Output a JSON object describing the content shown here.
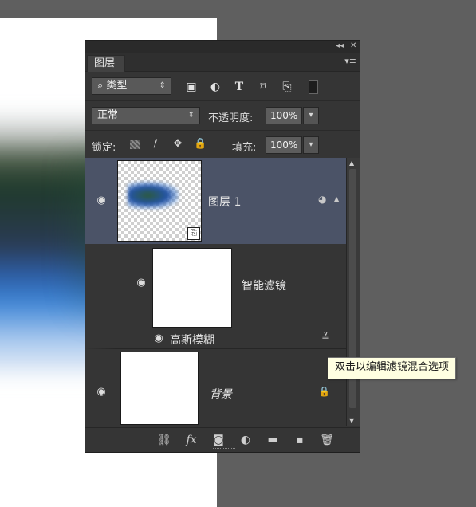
{
  "panel": {
    "tab_label": "图层",
    "panel_menu_icon": "panel-menu-icon",
    "top_controls": [
      "collapse-icon",
      "close-icon"
    ]
  },
  "filter": {
    "kind_label": "类型",
    "icons": [
      "pixel-filter-icon",
      "adjustment-filter-icon",
      "type-filter-icon",
      "shape-filter-icon",
      "smart-object-filter-icon",
      "filter-toggle-icon"
    ]
  },
  "blend": {
    "mode": "正常",
    "opacity_label": "不透明度:",
    "opacity_value": "100%"
  },
  "lock": {
    "label": "锁定:",
    "icons": [
      "lock-transparent-icon",
      "lock-pixels-icon",
      "lock-position-icon",
      "lock-all-icon"
    ],
    "fill_label": "填充:",
    "fill_value": "100%"
  },
  "layers": [
    {
      "name": "图层 1",
      "selected": true,
      "type": "smart-object"
    },
    {
      "name": "智能滤镜",
      "type": "smart-filters"
    },
    {
      "name": "高斯模糊",
      "type": "filter-item"
    },
    {
      "name": "背景",
      "type": "background",
      "locked": true
    }
  ],
  "tooltip": {
    "text": "双击以编辑滤镜混合选项"
  },
  "bottom_icons": [
    "link-layers-icon",
    "fx-icon",
    "add-mask-icon",
    "adjustment-layer-icon",
    "group-folder-icon",
    "new-layer-icon",
    "delete-layer-icon"
  ],
  "colors": {
    "panel_bg": "#353535",
    "selected_row": "#4b5367",
    "canvas": "#ffffff",
    "workspace": "#5f5f5f",
    "tooltip_bg": "#ffffe1"
  }
}
